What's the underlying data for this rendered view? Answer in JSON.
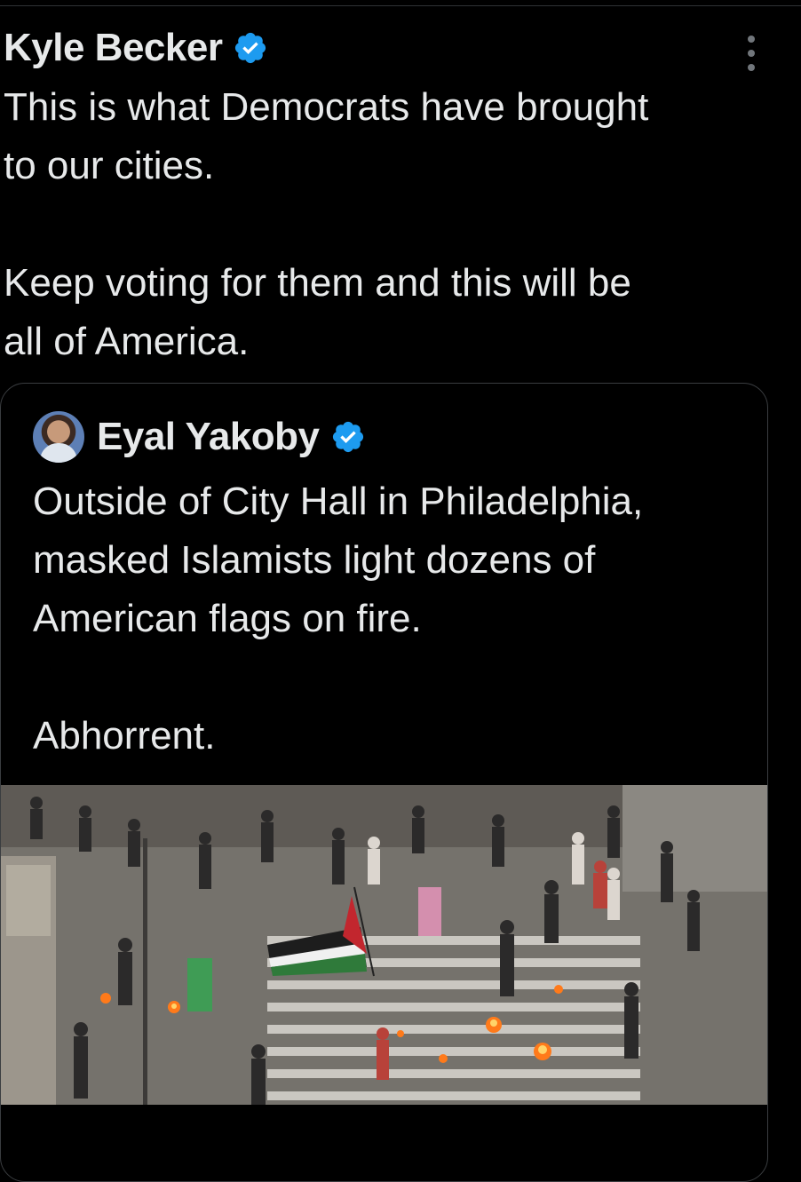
{
  "tweet": {
    "author_name": "Kyle Becker",
    "verified_icon": "verified-badge-icon",
    "text": "This is what Democrats have brought\nto our cities.\n\nKeep voting for them and this will be\nall of America."
  },
  "quoted_tweet": {
    "author_name": "Eyal Yakoby",
    "verified_icon": "verified-badge-icon",
    "text": "Outside of City Hall in Philadelphia,\nmasked Islamists light dozens of\nAmerican flags on fire.\n\nAbhorrent."
  },
  "colors": {
    "background": "#000000",
    "text": "#e7e9ea",
    "verified_blue": "#1d9bf0",
    "border": "#3a3d40",
    "muted": "#71767b"
  }
}
